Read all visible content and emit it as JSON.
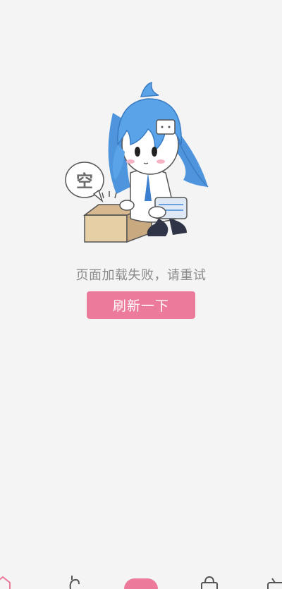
{
  "illustration": {
    "bubble_text": "空"
  },
  "error": {
    "message": "页面加载失败，请重试",
    "refresh_label": "刷新一下"
  },
  "colors": {
    "accent": "#eb7a9b",
    "background": "#f4f4f4",
    "hair": "#5aa3e8"
  },
  "tabbar": {
    "tabs": [
      {
        "icon": "home-icon"
      },
      {
        "icon": "channel-icon"
      },
      {
        "icon": "publish-icon"
      },
      {
        "icon": "mall-icon"
      },
      {
        "icon": "tv-icon"
      }
    ]
  }
}
